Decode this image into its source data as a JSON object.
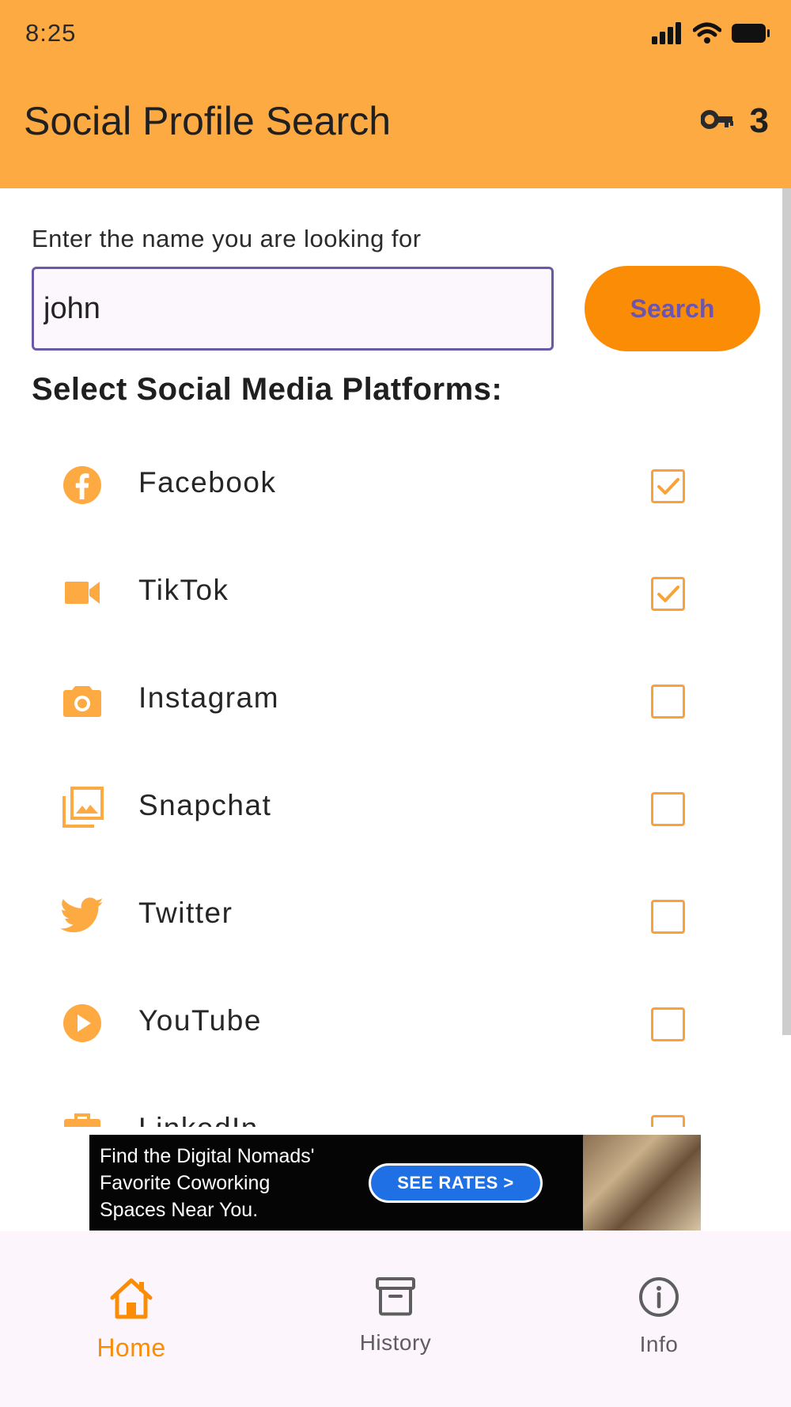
{
  "status_bar": {
    "time": "8:25"
  },
  "app_bar": {
    "title": "Social Profile Search",
    "key_count": "3",
    "key_icon": "key-icon"
  },
  "search": {
    "prompt": "Enter the name you are looking for",
    "value": "john",
    "button_label": "Search"
  },
  "platforms_section": {
    "title": "Select Social Media Platforms:",
    "items": [
      {
        "label": "Facebook",
        "icon": "facebook-icon",
        "checked": true
      },
      {
        "label": "TikTok",
        "icon": "video-camera-icon",
        "checked": true
      },
      {
        "label": "Instagram",
        "icon": "camera-icon",
        "checked": false
      },
      {
        "label": "Snapchat",
        "icon": "photo-library-icon",
        "checked": false
      },
      {
        "label": "Twitter",
        "icon": "twitter-bird-icon",
        "checked": false
      },
      {
        "label": "YouTube",
        "icon": "play-circle-icon",
        "checked": false
      },
      {
        "label": "LinkedIn",
        "icon": "briefcase-icon",
        "checked": false
      }
    ]
  },
  "ad": {
    "text_lines": [
      "Find the Digital Nomads'",
      "Favorite Coworking",
      "Spaces Near You."
    ],
    "cta": "SEE RATES >"
  },
  "bottom_nav": {
    "items": [
      {
        "label": "Home",
        "icon": "home-icon",
        "active": true
      },
      {
        "label": "History",
        "icon": "archive-icon",
        "active": false
      },
      {
        "label": "Info",
        "icon": "info-icon",
        "active": false
      }
    ]
  },
  "colors": {
    "app_bar": "#fdaa42",
    "accent": "#fb8c06",
    "checkbox": "#f9a239",
    "input_border": "#6a5aa6",
    "button_text": "#6b55b0"
  }
}
